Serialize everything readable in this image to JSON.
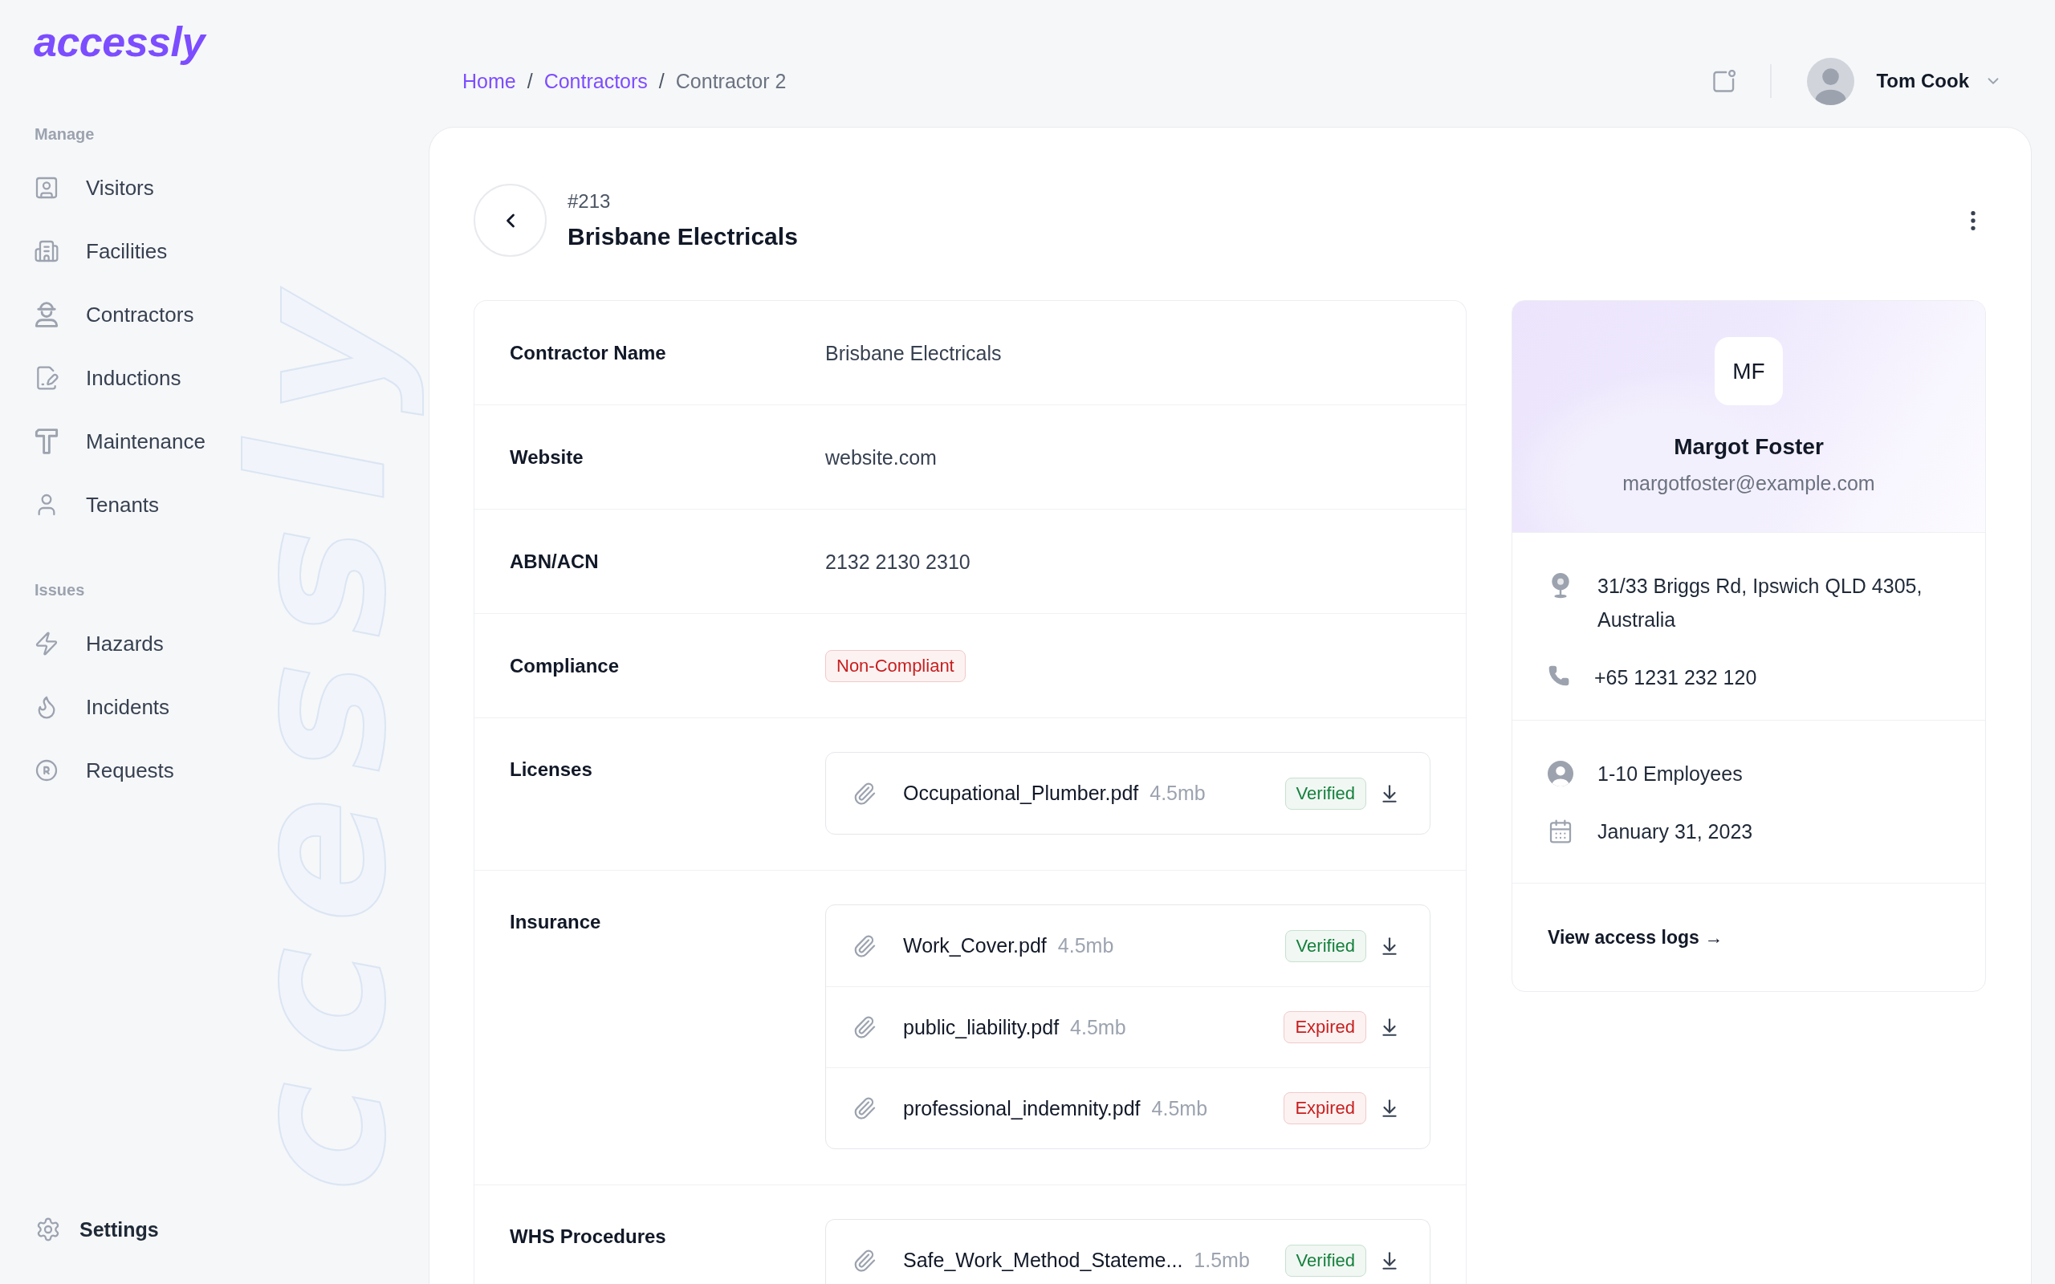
{
  "sidebar": {
    "logo": "accessly",
    "background_wordmark": "ccessly",
    "sections": [
      {
        "title": "Manage",
        "items": [
          {
            "label": "Visitors"
          },
          {
            "label": "Facilities"
          },
          {
            "label": "Contractors"
          },
          {
            "label": "Inductions"
          },
          {
            "label": "Maintenance"
          },
          {
            "label": "Tenants"
          }
        ]
      },
      {
        "title": "Issues",
        "items": [
          {
            "label": "Hazards"
          },
          {
            "label": "Incidents"
          },
          {
            "label": "Requests"
          }
        ]
      }
    ],
    "settings": {
      "label": "Settings"
    }
  },
  "breadcrumbs": [
    {
      "kind": "link",
      "label": "Home"
    },
    {
      "kind": "separator",
      "label": "/"
    },
    {
      "kind": "link",
      "label": "Contractors"
    },
    {
      "kind": "separator",
      "label": "/"
    },
    {
      "kind": "current",
      "label": "Contractor 2"
    }
  ],
  "user": {
    "name": "Tom Cook"
  },
  "record": {
    "number": "#213",
    "title": "Brisbane Electricals"
  },
  "details": [
    {
      "kind": "text",
      "label": "Contractor Name",
      "value": "Brisbane Electricals"
    },
    {
      "kind": "text",
      "label": "Website",
      "value": "website.com"
    },
    {
      "kind": "text",
      "label": "ABN/ACN",
      "value": "2132 2130 2310"
    },
    {
      "kind": "badge",
      "label": "Compliance",
      "value": "Non-Compliant",
      "color": "#c81e1e"
    },
    {
      "kind": "files",
      "label": "Licenses",
      "files": [
        {
          "name": "Occupational_Plumber.pdf",
          "size": "4.5mb",
          "badge": "Verified",
          "color": "#15803d"
        }
      ]
    },
    {
      "kind": "files",
      "label": "Insurance",
      "files": [
        {
          "name": "Work_Cover.pdf",
          "size": "4.5mb",
          "badge": "Verified",
          "color": "#15803d"
        },
        {
          "name": "public_liability.pdf",
          "size": "4.5mb",
          "badge": "Expired",
          "color": "#c81e1e"
        },
        {
          "name": "professional_indemnity.pdf",
          "size": "4.5mb",
          "badge": "Expired",
          "color": "#c81e1e"
        }
      ]
    },
    {
      "kind": "files",
      "label": "WHS Procedures",
      "files": [
        {
          "name": "Safe_Work_Method_Stateme...",
          "size": "1.5mb",
          "badge": "Verified",
          "color": "#15803d"
        }
      ]
    }
  ],
  "contact_card": {
    "initials": "MF",
    "name": "Margot Foster",
    "email": "margotfoster@example.com",
    "contact": [
      {
        "text": "31/33 Briggs Rd, Ipswich QLD 4305, Australia"
      },
      {
        "text": "+65 1231 232 120"
      }
    ],
    "facts": [
      {
        "text": "1-10 Employees"
      },
      {
        "text": "January 31, 2023"
      }
    ],
    "link": "View access logs →"
  }
}
